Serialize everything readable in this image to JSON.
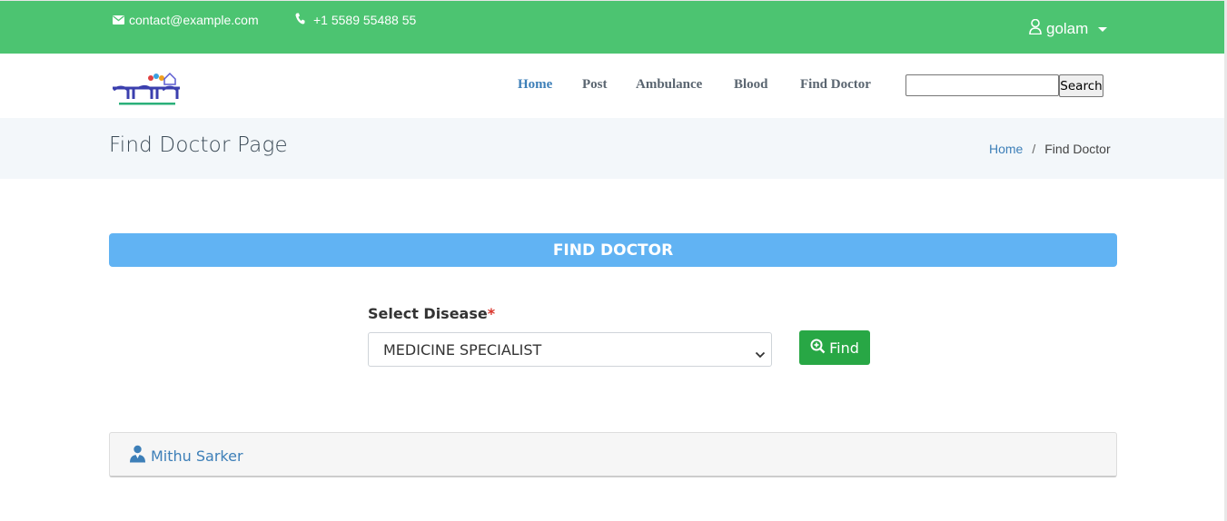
{
  "topbar": {
    "email": "contact@example.com",
    "phone": "+1 5589 55488 55",
    "user": "golam"
  },
  "nav": {
    "items": [
      {
        "label": "Home",
        "active": true
      },
      {
        "label": "Post",
        "active": false
      },
      {
        "label": "Ambulance",
        "active": false
      },
      {
        "label": "Blood",
        "active": false
      },
      {
        "label": "Find Doctor",
        "active": false
      }
    ],
    "search_button": "Search",
    "search_value": ""
  },
  "page": {
    "title": "Find Doctor Page",
    "breadcrumb": [
      "Home",
      "Find Doctor"
    ],
    "breadcrumb_sep": "/"
  },
  "find": {
    "header": "FIND DOCTOR",
    "label": "Select Disease",
    "required_mark": "*",
    "selected": "MEDICINE SPECIALIST",
    "button": "Find"
  },
  "results": [
    {
      "name": "Mithu Sarker"
    }
  ],
  "colors": {
    "topbar": "#4cc471",
    "header": "#61b3f3",
    "find_button": "#28a745",
    "link": "#3d7fb8"
  }
}
